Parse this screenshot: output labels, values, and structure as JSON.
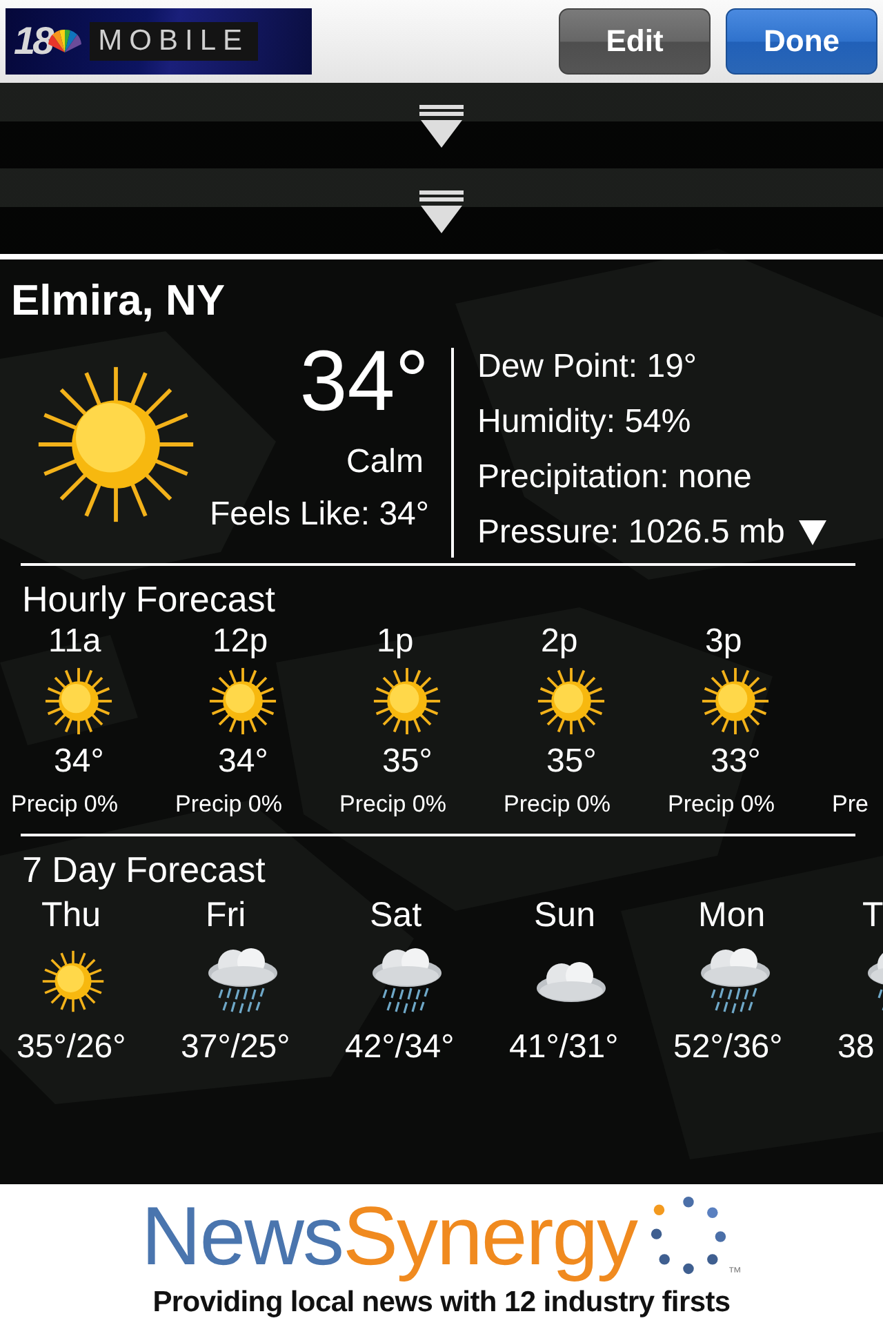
{
  "header": {
    "logo": {
      "number": "18",
      "word": "MOBILE"
    },
    "buttons": [
      {
        "label": "Edit",
        "kind": "plain"
      },
      {
        "label": "Done",
        "kind": "primary"
      }
    ]
  },
  "current": {
    "location": "Elmira, NY",
    "kind": "sun",
    "temperature": "34°",
    "condition": "Calm",
    "feels_like": "Feels Like: 34°",
    "details": [
      "Dew Point: 19°",
      "Humidity: 54%",
      "Precipitation: none",
      "Pressure: 1026.5 mb"
    ]
  },
  "hourly": {
    "title": "Hourly Forecast",
    "items": [
      {
        "time": "11a",
        "kind": "sun",
        "temp": "34°",
        "precip": "Precip 0%"
      },
      {
        "time": "12p",
        "kind": "sun",
        "temp": "34°",
        "precip": "Precip 0%"
      },
      {
        "time": "1p",
        "kind": "sun",
        "temp": "35°",
        "precip": "Precip 0%"
      },
      {
        "time": "2p",
        "kind": "sun",
        "temp": "35°",
        "precip": "Precip 0%"
      },
      {
        "time": "3p",
        "kind": "sun",
        "temp": "33°",
        "precip": "Precip 0%"
      },
      {
        "precip": "Pre"
      }
    ]
  },
  "daily": {
    "title": "7 Day Forecast",
    "items": [
      {
        "day": "Thu",
        "kind": "sun",
        "temps": "35°/26°"
      },
      {
        "day": "Fri",
        "kind": "rain",
        "temps": "37°/25°"
      },
      {
        "day": "Sat",
        "kind": "rain",
        "temps": "42°/34°"
      },
      {
        "day": "Sun",
        "kind": "cloud",
        "temps": "41°/31°"
      },
      {
        "day": "Mon",
        "kind": "rain",
        "temps": "52°/36°"
      },
      {
        "day": "T",
        "kind": "rain",
        "temps": "38"
      }
    ]
  },
  "ad": {
    "brand_first": "News",
    "brand_second": "Synergy",
    "trademark": "™",
    "tagline": "Providing local news with 12 industry firsts"
  }
}
